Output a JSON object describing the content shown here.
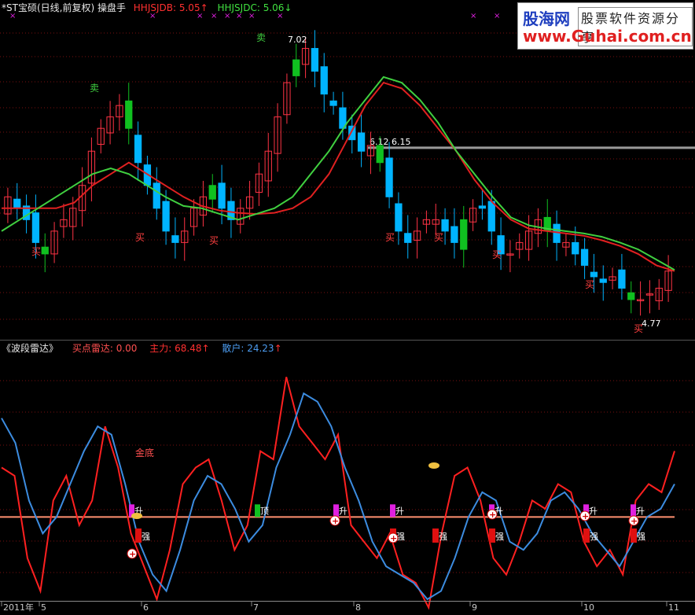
{
  "top_panel": {
    "title": "*ST宝硕(日线,前复权) 操盘手",
    "ind1_label": "HHJSJDB: 5.05",
    "ind1_arrow": "↑",
    "ind2_label": "HHJSJDC: 5.06",
    "ind2_arrow": "↓",
    "marks": [
      "卖",
      "卖",
      "买",
      "买",
      "买",
      "买",
      "买",
      "买",
      "买",
      "买"
    ],
    "high_label": "7.02",
    "low_label": "4.77",
    "level_label": "6.12 6.15",
    "x_marker": "×"
  },
  "bottom_panel": {
    "title": "《波段雷达》",
    "buy_radar": "买点雷达: 0.00",
    "main_force": "主力: 68.48",
    "main_force_arrow": "↑",
    "retail": "散户: 24.23",
    "retail_arrow": "↑",
    "sign_labels": {
      "bottom": "金底",
      "rise": "升",
      "top": "顶",
      "strong": "强"
    }
  },
  "x_axis": [
    "2011年",
    "5",
    "6",
    "7",
    "8",
    "9",
    "10",
    "11"
  ],
  "watermark": {
    "logo": "股海网",
    "slogan": "股票软件资源分享",
    "url": "www.Guhai.com.cn"
  },
  "colors": {
    "up": "#ff3344",
    "down": "#00b4ff",
    "green": "#10c020",
    "ma_red": "#e02020",
    "ma_green": "#40d040",
    "panel_red": "#ff2020",
    "panel_blue": "#3c8ce0",
    "zero_line": "#ff9070",
    "magenta": "#e020e0",
    "grid": "#7a1010"
  },
  "chart_data": [
    {
      "type": "candlestick",
      "title": "*ST宝硕(日线,前复权) 操盘手",
      "x": [
        "2011年",
        "5",
        "6",
        "7",
        "8",
        "9",
        "10",
        "11"
      ],
      "ylim": [
        4.6,
        7.3
      ],
      "series": [
        {
          "values": [
            5.7,
            5.6,
            5.5,
            5.3,
            5.2,
            5.4,
            5.5,
            5.6,
            5.8,
            6.1,
            6.3,
            6.4,
            6.5,
            6.3,
            6.0,
            5.8,
            5.6,
            5.4,
            5.3,
            5.4,
            5.6,
            5.7,
            5.8,
            5.6,
            5.5,
            5.6,
            5.7,
            5.9,
            6.1,
            6.4,
            6.7,
            6.9,
            7.0,
            6.8,
            6.6,
            6.5,
            6.3,
            6.2,
            6.1,
            6.15,
            6.0,
            5.7,
            5.4,
            5.3,
            5.4,
            5.5,
            5.5,
            5.4,
            5.3,
            5.5,
            5.6,
            5.6,
            5.4,
            5.2,
            5.2,
            5.3,
            5.4,
            5.5,
            5.4,
            5.3,
            5.3,
            5.2,
            5.1,
            5.0,
            4.95,
            5.0,
            4.9,
            4.8,
            4.8,
            4.85,
            4.9,
            5.05
          ]
        },
        {
          "name": "HHJSJDB",
          "values": [
            5.6,
            5.6,
            5.6,
            5.6,
            5.65,
            5.8,
            5.9,
            6.0,
            5.9,
            5.8,
            5.7,
            5.62,
            5.58,
            5.56,
            5.55,
            5.56,
            5.6,
            5.7,
            5.9,
            6.2,
            6.5,
            6.7,
            6.65,
            6.5,
            6.3,
            6.1,
            5.85,
            5.65,
            5.5,
            5.42,
            5.4,
            5.38,
            5.36,
            5.32,
            5.27,
            5.2,
            5.1,
            5.05
          ]
        },
        {
          "name": "HHJSJDC",
          "values": [
            5.4,
            5.5,
            5.6,
            5.7,
            5.8,
            5.9,
            5.95,
            5.9,
            5.8,
            5.7,
            5.62,
            5.6,
            5.55,
            5.5,
            5.55,
            5.6,
            5.7,
            5.9,
            6.1,
            6.35,
            6.55,
            6.75,
            6.7,
            6.55,
            6.35,
            6.1,
            5.9,
            5.7,
            5.52,
            5.45,
            5.42,
            5.4,
            5.38,
            5.35,
            5.3,
            5.24,
            5.15,
            5.06
          ]
        }
      ],
      "annotations": [
        "7.02",
        "4.77",
        "6.12 6.15",
        "卖",
        "买"
      ]
    },
    {
      "type": "line",
      "title": "《波段雷达》",
      "x": [
        "2011年",
        "5",
        "6",
        "7",
        "8",
        "9",
        "10",
        "11"
      ],
      "ylim": [
        -50,
        100
      ],
      "series": [
        {
          "name": "主力",
          "values": [
            30,
            25,
            -25,
            -45,
            10,
            25,
            -5,
            10,
            55,
            30,
            -10,
            -30,
            -50,
            -20,
            20,
            30,
            35,
            10,
            -20,
            -5,
            40,
            35,
            85,
            55,
            45,
            35,
            50,
            -5,
            -15,
            -25,
            -10,
            -35,
            -40,
            -55,
            -10,
            25,
            30,
            10,
            -25,
            -35,
            -15,
            10,
            5,
            20,
            15,
            -15,
            -30,
            -20,
            -35,
            10,
            20,
            15,
            40
          ]
        },
        {
          "name": "散户",
          "values": [
            60,
            45,
            10,
            -10,
            0,
            20,
            40,
            55,
            50,
            20,
            -15,
            -35,
            -45,
            -20,
            10,
            25,
            20,
            5,
            -15,
            -5,
            30,
            50,
            75,
            70,
            55,
            30,
            10,
            -15,
            -30,
            -35,
            -40,
            -50,
            -45,
            -25,
            0,
            15,
            10,
            -15,
            -20,
            -10,
            10,
            15,
            5,
            -10,
            -20,
            -30,
            -15,
            0,
            5,
            20
          ]
        }
      ],
      "annotations": [
        "金底",
        "升",
        "顶",
        "强",
        "买点雷达: 0.00",
        "主力: 68.48",
        "散户: 24.23"
      ]
    }
  ]
}
